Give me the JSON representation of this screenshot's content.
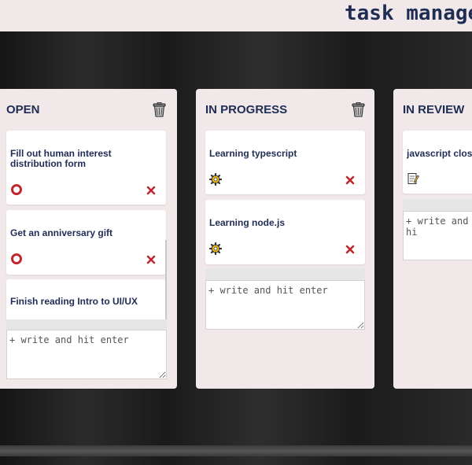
{
  "app": {
    "title": "task managem"
  },
  "columns": {
    "open": {
      "title": "OPEN",
      "cards": [
        {
          "title": "Fill out human interest distribution form",
          "status_icon": "circle-ring-icon"
        },
        {
          "title": "Get an anniversary gift",
          "status_icon": "circle-ring-icon"
        },
        {
          "title": "Finish reading Intro to UI/UX"
        }
      ],
      "input_placeholder": "+ write and hit enter"
    },
    "progress": {
      "title": "IN PROGRESS",
      "cards": [
        {
          "title": "Learning typescript",
          "status_icon": "gear-icon"
        },
        {
          "title": "Learning node.js",
          "status_icon": "gear-icon"
        }
      ],
      "input_placeholder": "+ write and hit enter"
    },
    "review": {
      "title": "IN REVIEW",
      "cards": [
        {
          "title": "javascript closu",
          "status_icon": "memo-icon"
        }
      ],
      "input_placeholder": "+ write and hi"
    }
  },
  "colors": {
    "column_bg": "#f1e9e9",
    "title_text": "#1f2d55",
    "delete_red": "#c0272d",
    "ring_red": "#c0272d",
    "gear_yellow": "#f5c21b"
  }
}
